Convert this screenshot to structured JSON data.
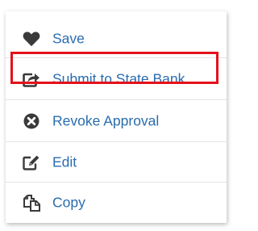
{
  "menu": {
    "items": [
      {
        "id": "save",
        "label": "Save",
        "icon": "heart-icon"
      },
      {
        "id": "submit",
        "label": "Submit to State Bank",
        "icon": "share-square-icon"
      },
      {
        "id": "revoke",
        "label": "Revoke Approval",
        "icon": "times-circle-icon"
      },
      {
        "id": "edit",
        "label": "Edit",
        "icon": "edit-icon"
      },
      {
        "id": "copy",
        "label": "Copy",
        "icon": "copy-icon"
      }
    ]
  },
  "colors": {
    "link": "#2a6cae",
    "icon": "#3a3a3a",
    "highlight": "#e3121b"
  }
}
